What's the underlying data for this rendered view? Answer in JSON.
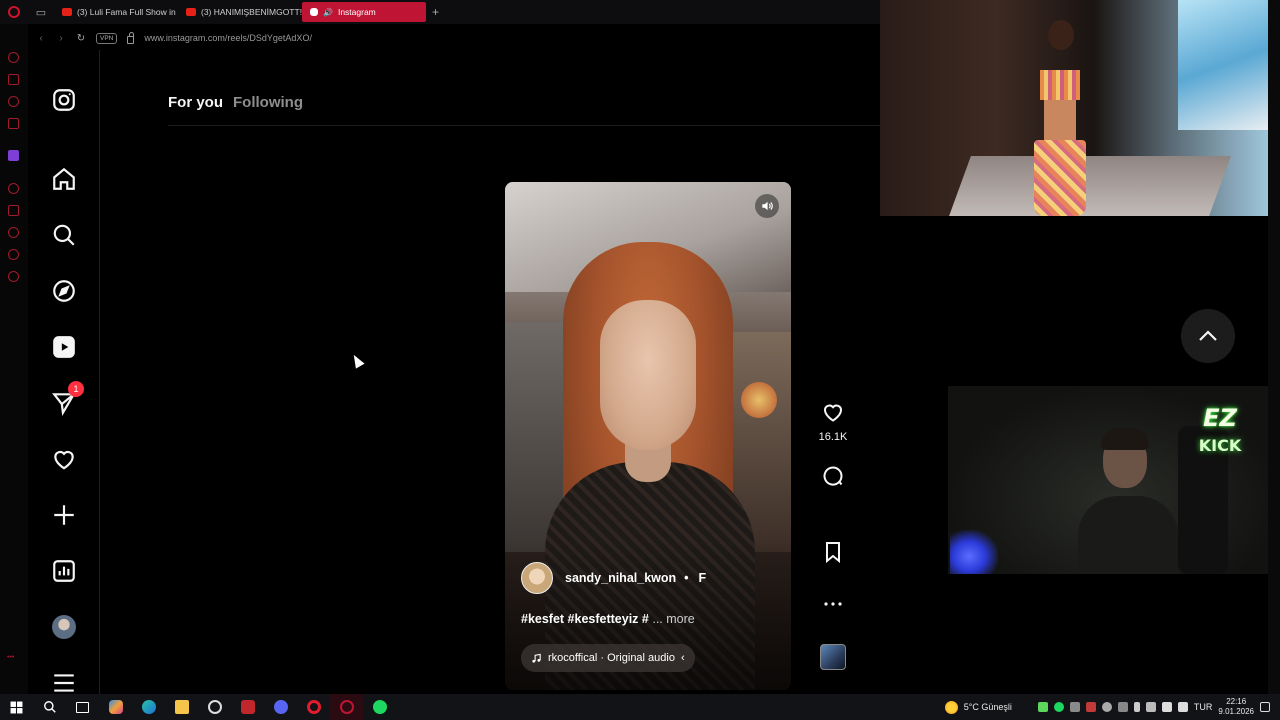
{
  "browser": {
    "tabs": [
      {
        "label": "(3) Luli Fama Full Show in",
        "kind": "youtube",
        "active": false
      },
      {
        "label": "(3) HANIMIŞBENİMGOTT!",
        "kind": "youtube",
        "active": false
      },
      {
        "label": "Instagram",
        "kind": "instagram",
        "active": true
      }
    ],
    "new_tab": "+",
    "vpn_label": "VPN",
    "url": "www.instagram.com/reels/DSdYgetAdXO/"
  },
  "feed": {
    "tabs": [
      {
        "label": "For you",
        "active": true
      },
      {
        "label": "Following",
        "active": false
      }
    ]
  },
  "nav": {
    "icons": [
      "instagram-logo",
      "home",
      "search",
      "explore",
      "reels",
      "messages",
      "notifications",
      "create",
      "dashboard",
      "profile",
      "more-menu"
    ],
    "messages_badge": "1"
  },
  "reel": {
    "username": "sandy_nihal_kwon",
    "separator": "•",
    "follow_initial": "F",
    "caption": "#kesfet #kesfetteyiz #",
    "caption_more": "... more",
    "audio": "rkocoffical · Original audio",
    "audio_trail": "‹"
  },
  "actions": {
    "likes": "16.1K"
  },
  "taskbar": {
    "weather": "5°C  Güneşli",
    "lang": "TUR",
    "time": "22:16",
    "date": "9.01.2026"
  },
  "overlay": {
    "ez": "EZ",
    "kick": "KICK"
  },
  "colors": {
    "opera_red": "#c01434",
    "badge": "#ff3040",
    "kick_green": "#3fe03f"
  }
}
